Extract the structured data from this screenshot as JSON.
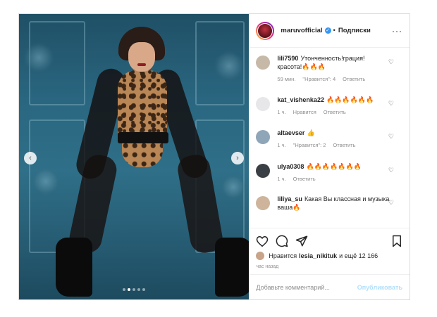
{
  "header": {
    "username": "maruvofficial",
    "separator": "•",
    "follow_label": "Подписки",
    "more_label": "···"
  },
  "comments": [
    {
      "user": "lili7590",
      "text": "Утонченность!грация! красота!🔥🔥🔥",
      "time": "59 мин.",
      "likes": "\"Нравится\": 4",
      "reply": "Ответить"
    },
    {
      "user": "kat_vishenka22",
      "text": "🔥🔥🔥🔥🔥🔥",
      "time": "1 ч.",
      "likes": "Нравится",
      "reply": "Ответить"
    },
    {
      "user": "altaevser",
      "text": "👍",
      "time": "1 ч.",
      "likes": "\"Нравится\": 2",
      "reply": "Ответить"
    },
    {
      "user": "ulya0308",
      "text": "🔥🔥🔥🔥🔥🔥🔥",
      "time": "1 ч.",
      "likes": "",
      "reply": "Ответить"
    },
    {
      "user": "liliya_su",
      "text": "Какая Вы классная и музыка ваша🔥",
      "time": "",
      "likes": "",
      "reply": ""
    }
  ],
  "likes": {
    "prefix": "Нравится",
    "user": "lesia_nikituk",
    "suffix": "и ещё 12 166"
  },
  "time_ago": "час назад",
  "add_comment": {
    "placeholder": "Добавьте комментарий...",
    "publish_label": "Опубликовать"
  },
  "carousel": {
    "count": 5,
    "active_index": 1
  }
}
